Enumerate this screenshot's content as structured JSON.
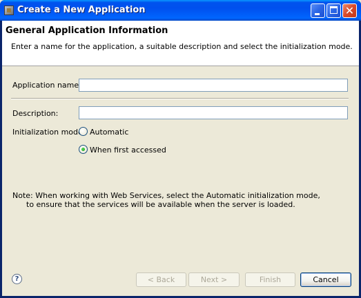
{
  "window": {
    "title": "Create a New Application",
    "icon": "eclipse-app-icon",
    "controls": {
      "minimize": "minimize-icon",
      "maximize": "maximize-icon",
      "close": "✕"
    }
  },
  "header": {
    "title": "General Application Information",
    "description": "Enter a name for the application, a suitable description and select the initialization mode."
  },
  "form": {
    "app_name_label": "Application name:",
    "app_name_value": "",
    "description_label": "Description:",
    "description_value": "",
    "init_mode_label": "Initialization mode:",
    "init_options": [
      {
        "label": "Automatic",
        "selected": false
      },
      {
        "label": "When first accessed",
        "selected": true
      }
    ]
  },
  "note": {
    "line1": "Note: When working with Web Services, select the Automatic initialization mode,",
    "line2": "to ensure that the services will be available when the server is loaded."
  },
  "footer": {
    "help": "?",
    "back": "< Back",
    "next": "Next >",
    "finish": "Finish",
    "cancel": "Cancel"
  }
}
